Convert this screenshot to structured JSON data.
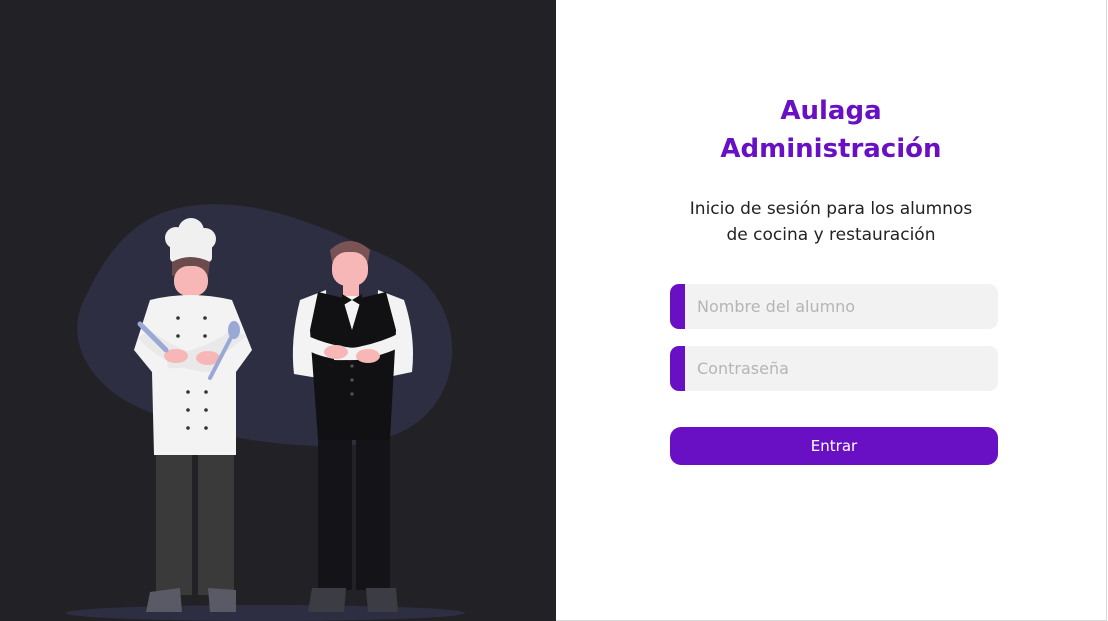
{
  "brand": {
    "line1": "Aulaga",
    "line2": "Administración",
    "accent_color": "#6a10c4"
  },
  "subtitle": {
    "line1": "Inicio de sesión para los alumnos",
    "line2": "de cocina y restauración"
  },
  "form": {
    "username_placeholder": "Nombre del alumno",
    "password_placeholder": "Contraseña",
    "submit_label": "Entrar"
  },
  "illustration": {
    "panel_color": "#222226",
    "icon": "chef-and-waiter-illustration"
  }
}
